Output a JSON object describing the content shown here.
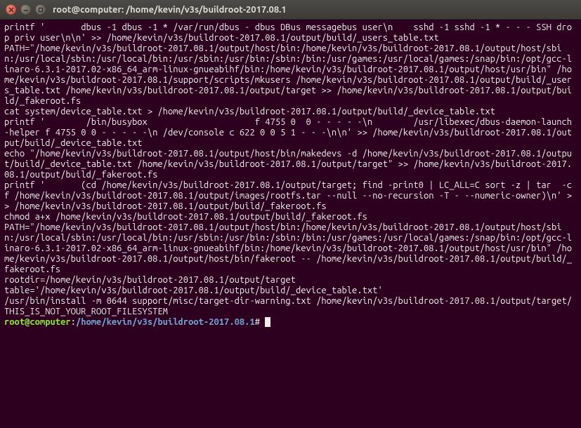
{
  "window": {
    "title": "root@computer: /home/kevin/v3s/buildroot-2017.08.1"
  },
  "terminal": {
    "output": "printf '       dbus -1 dbus -1 * /var/run/dbus - dbus DBus messagebus user\\n    sshd -1 sshd -1 * - - - SSH drop priv user\\n\\n' >> /home/kevin/v3s/buildroot-2017.08.1/output/build/_users_table.txt\nPATH=\"/home/kevin/v3s/buildroot-2017.08.1/output/host/bin:/home/kevin/v3s/buildroot-2017.08.1/output/host/sbin:/usr/local/sbin:/usr/local/bin:/usr/sbin:/usr/bin:/sbin:/bin:/usr/games:/usr/local/games:/snap/bin:/opt/gcc-linaro-6.3.1-2017.02-x86_64_arm-linux-gnueabihf/bin:/home/kevin/v3s/buildroot-2017.08.1/output/host/usr/bin\" /home/kevin/v3s/buildroot-2017.08.1/support/scripts/mkusers /home/kevin/v3s/buildroot-2017.08.1/output/build/_users_table.txt /home/kevin/v3s/buildroot-2017.08.1/output/target >> /home/kevin/v3s/buildroot-2017.08.1/output/build/_fakeroot.fs\ncat system/device_table.txt > /home/kevin/v3s/buildroot-2017.08.1/output/build/_device_table.txt\nprintf '        /bin/busybox                     f 4755 0  0 - - - - -\\n        /usr/libexec/dbus-daemon-launch-helper f 4755 0 0 - - - - -\\n /dev/console c 622 0 0 5 1 - - -\\n\\n' >> /home/kevin/v3s/buildroot-2017.08.1/output/build/_device_table.txt\necho \"/home/kevin/v3s/buildroot-2017.08.1/output/host/bin/makedevs -d /home/kevin/v3s/buildroot-2017.08.1/output/build/_device_table.txt /home/kevin/v3s/buildroot-2017.08.1/output/target\" >> /home/kevin/v3s/buildroot-2017.08.1/output/build/_fakeroot.fs\nprintf '       (cd /home/kevin/v3s/buildroot-2017.08.1/output/target; find -print0 | LC_ALL=C sort -z | tar  -cf /home/kevin/v3s/buildroot-2017.08.1/output/images/rootfs.tar --null --no-recursion -T - --numeric-owner)\\n' >> /home/kevin/v3s/buildroot-2017.08.1/output/build/_fakeroot.fs\nchmod a+x /home/kevin/v3s/buildroot-2017.08.1/output/build/_fakeroot.fs\nPATH=\"/home/kevin/v3s/buildroot-2017.08.1/output/host/bin:/home/kevin/v3s/buildroot-2017.08.1/output/host/sbin:/usr/local/sbin:/usr/local/bin:/usr/sbin:/usr/bin:/sbin:/bin:/usr/games:/usr/local/games:/snap/bin:/opt/gcc-linaro-6.3.1-2017.02-x86_64_arm-linux-gnueabihf/bin:/home/kevin/v3s/buildroot-2017.08.1/output/host/usr/bin\" /home/kevin/v3s/buildroot-2017.08.1/output/host/bin/fakeroot -- /home/kevin/v3s/buildroot-2017.08.1/output/build/_fakeroot.fs\nrootdir=/home/kevin/v3s/buildroot-2017.08.1/output/target\ntable='/home/kevin/v3s/buildroot-2017.08.1/output/build/_device_table.txt'\n/usr/bin/install -m 0644 support/misc/target-dir-warning.txt /home/kevin/v3s/buildroot-2017.08.1/output/target/THIS_IS_NOT_YOUR_ROOT_FILESYSTEM",
    "prompt": {
      "user_host": "root@computer",
      "colon": ":",
      "path": "/home/kevin/v3s/buildroot-2017.08.1",
      "symbol": "#"
    }
  }
}
